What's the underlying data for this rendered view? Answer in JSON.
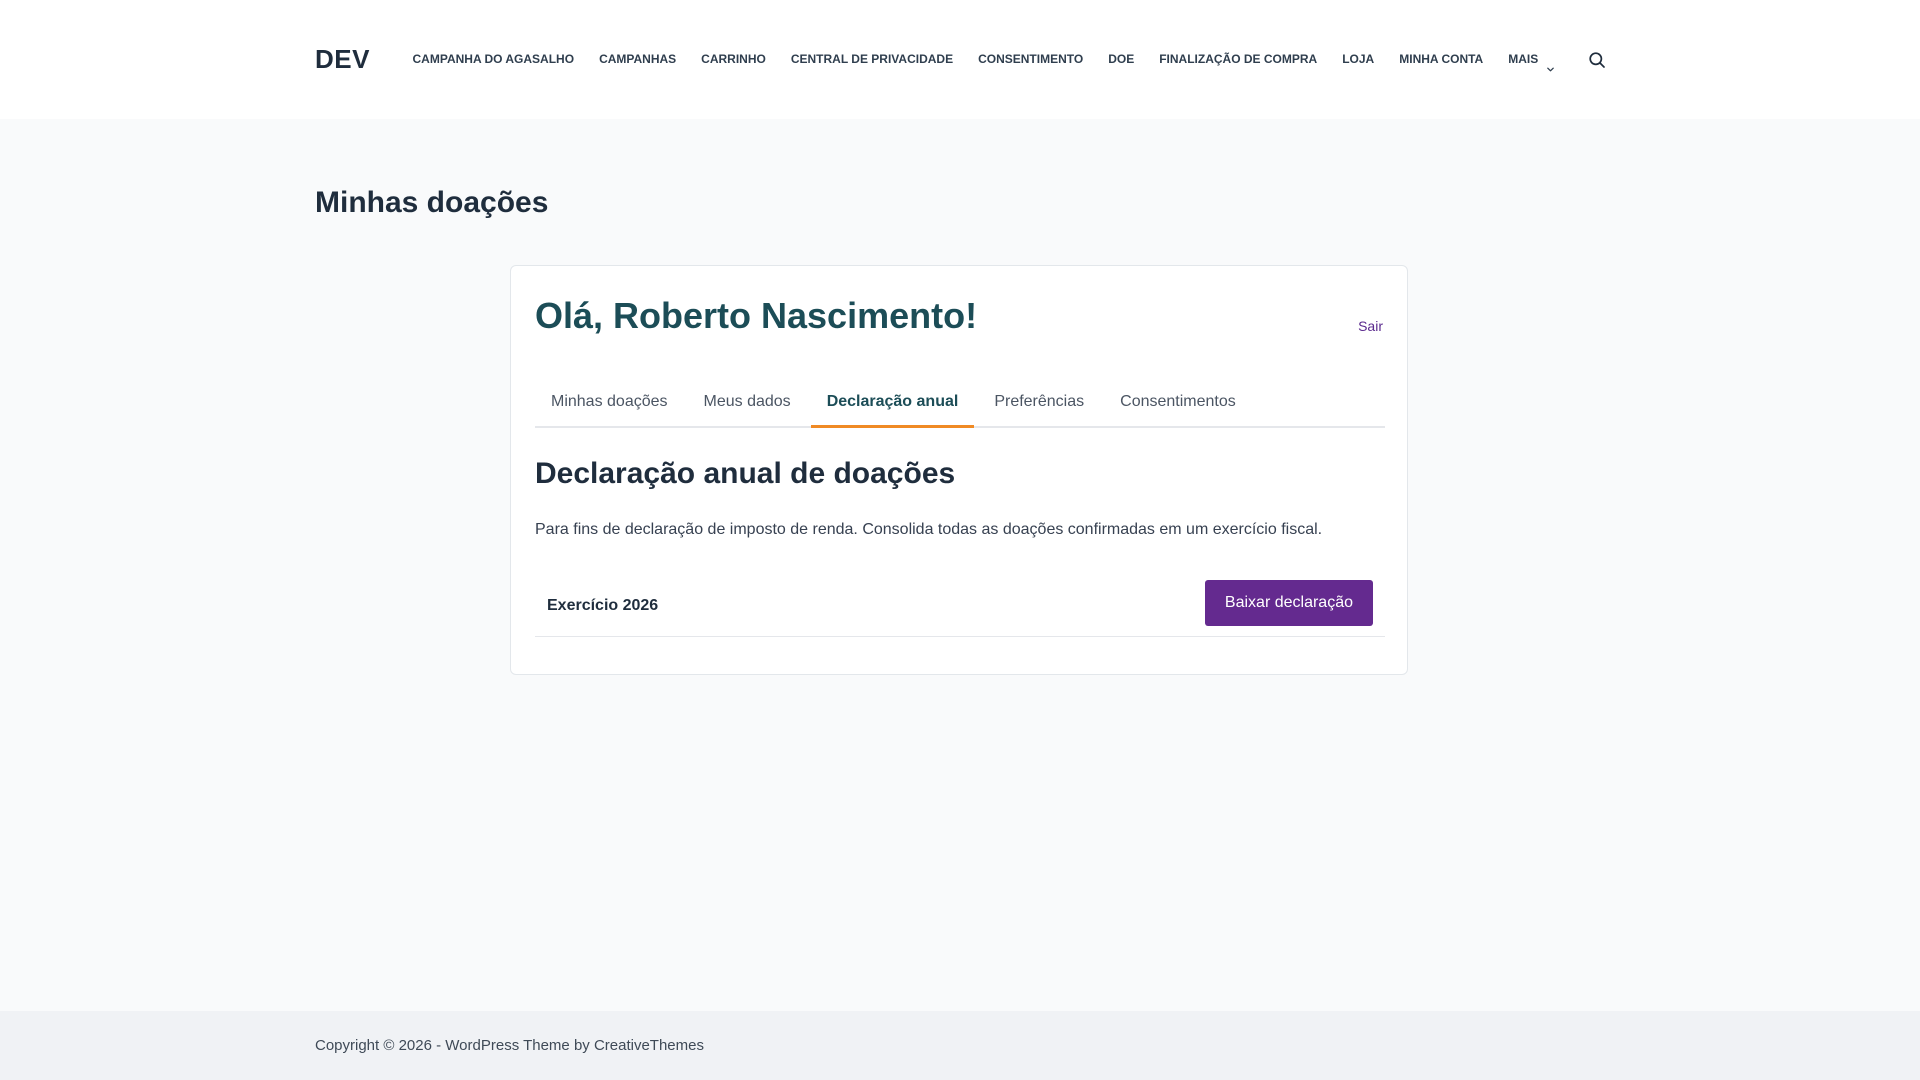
{
  "header": {
    "logo": "DEV",
    "nav": [
      {
        "label": "CAMPANHA DO AGASALHO"
      },
      {
        "label": "CAMPANHAS"
      },
      {
        "label": "CARRINHO"
      },
      {
        "label": "CENTRAL DE PRIVACIDADE"
      },
      {
        "label": "CONSENTIMENTO"
      },
      {
        "label": "DOE"
      },
      {
        "label": "FINALIZAÇÃO DE COMPRA"
      },
      {
        "label": "LOJA"
      },
      {
        "label": "MINHA CONTA"
      },
      {
        "label": "MAIS",
        "icon": "chevron-down-icon"
      }
    ],
    "search_icon": "search-icon"
  },
  "page": {
    "title": "Minhas doações"
  },
  "account": {
    "greeting": "Olá, Roberto Nascimento!",
    "logout": "Sair",
    "tabs": [
      {
        "label": "Minhas doações",
        "active": false
      },
      {
        "label": "Meus dados",
        "active": false
      },
      {
        "label": "Declaração anual",
        "active": true
      },
      {
        "label": "Preferências",
        "active": false
      },
      {
        "label": "Consentimentos",
        "active": false
      }
    ],
    "section_title": "Declaração anual de doações",
    "section_description": "Para fins de declaração de imposto de renda. Consolida todas as doações confirmadas em um exercício fiscal.",
    "year_label": "Exercício 2026",
    "download_button": "Baixar declaração"
  },
  "footer": {
    "copyright": "Copyright © 2026 - WordPress Theme by CreativeThemes"
  },
  "colors": {
    "accent_purple": "#642a8f",
    "tab_underline": "#f08a24",
    "greeting_teal": "#1c4d57"
  }
}
